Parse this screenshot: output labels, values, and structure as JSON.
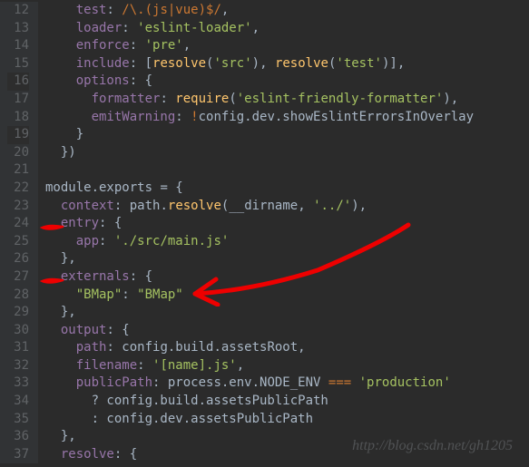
{
  "lines": [
    {
      "num": 12,
      "segs": [
        {
          "t": "    ",
          "c": ""
        },
        {
          "t": "test",
          "c": "kw-prop"
        },
        {
          "t": ": ",
          "c": ""
        },
        {
          "t": "/\\.(js|vue)$/",
          "c": "regex"
        },
        {
          "t": ",",
          "c": ""
        }
      ]
    },
    {
      "num": 13,
      "segs": [
        {
          "t": "    ",
          "c": ""
        },
        {
          "t": "loader",
          "c": "kw-prop"
        },
        {
          "t": ": ",
          "c": ""
        },
        {
          "t": "'eslint-loader'",
          "c": "str"
        },
        {
          "t": ",",
          "c": ""
        }
      ]
    },
    {
      "num": 14,
      "segs": [
        {
          "t": "    ",
          "c": ""
        },
        {
          "t": "enforce",
          "c": "kw-prop"
        },
        {
          "t": ": ",
          "c": ""
        },
        {
          "t": "'pre'",
          "c": "str"
        },
        {
          "t": ",",
          "c": ""
        }
      ]
    },
    {
      "num": 15,
      "segs": [
        {
          "t": "    ",
          "c": ""
        },
        {
          "t": "include",
          "c": "kw-prop"
        },
        {
          "t": ": [",
          "c": ""
        },
        {
          "t": "resolve",
          "c": "func"
        },
        {
          "t": "(",
          "c": ""
        },
        {
          "t": "'src'",
          "c": "str"
        },
        {
          "t": "), ",
          "c": ""
        },
        {
          "t": "resolve",
          "c": "func"
        },
        {
          "t": "(",
          "c": ""
        },
        {
          "t": "'test'",
          "c": "str"
        },
        {
          "t": ")],",
          "c": ""
        }
      ]
    },
    {
      "num": 16,
      "segs": [
        {
          "t": "    ",
          "c": ""
        },
        {
          "t": "options",
          "c": "kw-prop"
        },
        {
          "t": ": {",
          "c": ""
        }
      ],
      "hl": true
    },
    {
      "num": 17,
      "segs": [
        {
          "t": "      ",
          "c": ""
        },
        {
          "t": "formatter",
          "c": "kw-prop"
        },
        {
          "t": ": ",
          "c": ""
        },
        {
          "t": "require",
          "c": "func"
        },
        {
          "t": "(",
          "c": ""
        },
        {
          "t": "'eslint-friendly-formatter'",
          "c": "str"
        },
        {
          "t": "),",
          "c": ""
        }
      ]
    },
    {
      "num": 18,
      "segs": [
        {
          "t": "      ",
          "c": ""
        },
        {
          "t": "emitWarning",
          "c": "kw-prop"
        },
        {
          "t": ": ",
          "c": ""
        },
        {
          "t": "!",
          "c": "red-op"
        },
        {
          "t": "config.dev.showEslintErrorsInOverlay",
          "c": "ident"
        }
      ]
    },
    {
      "num": 19,
      "segs": [
        {
          "t": "    }",
          "c": ""
        }
      ],
      "hl": true
    },
    {
      "num": 20,
      "segs": [
        {
          "t": "  })",
          "c": ""
        }
      ]
    },
    {
      "num": 21,
      "segs": [
        {
          "t": "",
          "c": ""
        }
      ]
    },
    {
      "num": 22,
      "segs": [
        {
          "t": "module.exports ",
          "c": "ident"
        },
        {
          "t": "= ",
          "c": "op"
        },
        {
          "t": "{",
          "c": ""
        }
      ]
    },
    {
      "num": 23,
      "segs": [
        {
          "t": "  ",
          "c": ""
        },
        {
          "t": "context",
          "c": "kw-prop"
        },
        {
          "t": ": path.",
          "c": ""
        },
        {
          "t": "resolve",
          "c": "func"
        },
        {
          "t": "(__dirname, ",
          "c": ""
        },
        {
          "t": "'../'",
          "c": "str"
        },
        {
          "t": "),",
          "c": ""
        }
      ]
    },
    {
      "num": 24,
      "segs": [
        {
          "t": "  ",
          "c": ""
        },
        {
          "t": "entry",
          "c": "kw-prop"
        },
        {
          "t": ": {",
          "c": ""
        }
      ]
    },
    {
      "num": 25,
      "segs": [
        {
          "t": "    ",
          "c": ""
        },
        {
          "t": "app",
          "c": "kw-prop"
        },
        {
          "t": ": ",
          "c": ""
        },
        {
          "t": "'./src/main.js'",
          "c": "str"
        }
      ]
    },
    {
      "num": 26,
      "segs": [
        {
          "t": "  },",
          "c": ""
        }
      ]
    },
    {
      "num": 27,
      "segs": [
        {
          "t": "  ",
          "c": ""
        },
        {
          "t": "externals",
          "c": "kw-prop"
        },
        {
          "t": ": {",
          "c": ""
        }
      ]
    },
    {
      "num": 28,
      "segs": [
        {
          "t": "    ",
          "c": ""
        },
        {
          "t": "\"BMap\"",
          "c": "str"
        },
        {
          "t": ": ",
          "c": ""
        },
        {
          "t": "\"BMap\"",
          "c": "str"
        }
      ]
    },
    {
      "num": 29,
      "segs": [
        {
          "t": "  },",
          "c": ""
        }
      ]
    },
    {
      "num": 30,
      "segs": [
        {
          "t": "  ",
          "c": ""
        },
        {
          "t": "output",
          "c": "kw-prop"
        },
        {
          "t": ": {",
          "c": ""
        }
      ]
    },
    {
      "num": 31,
      "segs": [
        {
          "t": "    ",
          "c": ""
        },
        {
          "t": "path",
          "c": "kw-prop"
        },
        {
          "t": ": config.build.assetsRoot,",
          "c": ""
        }
      ]
    },
    {
      "num": 32,
      "segs": [
        {
          "t": "    ",
          "c": ""
        },
        {
          "t": "filename",
          "c": "kw-prop"
        },
        {
          "t": ": ",
          "c": ""
        },
        {
          "t": "'[name].js'",
          "c": "str"
        },
        {
          "t": ",",
          "c": ""
        }
      ]
    },
    {
      "num": 33,
      "segs": [
        {
          "t": "    ",
          "c": ""
        },
        {
          "t": "publicPath",
          "c": "kw-prop"
        },
        {
          "t": ": process.env.NODE_ENV ",
          "c": ""
        },
        {
          "t": "=== ",
          "c": "red-op"
        },
        {
          "t": "'production'",
          "c": "str"
        }
      ]
    },
    {
      "num": 34,
      "segs": [
        {
          "t": "      ? config.build.assetsPublicPath",
          "c": ""
        }
      ]
    },
    {
      "num": 35,
      "segs": [
        {
          "t": "      : config.dev.assetsPublicPath",
          "c": ""
        }
      ]
    },
    {
      "num": 36,
      "segs": [
        {
          "t": "  },",
          "c": ""
        }
      ]
    },
    {
      "num": 37,
      "segs": [
        {
          "t": "  ",
          "c": ""
        },
        {
          "t": "resolve",
          "c": "kw-prop"
        },
        {
          "t": ": {",
          "c": ""
        }
      ]
    }
  ],
  "watermark": "http://blog.csdn.net/gh1205"
}
